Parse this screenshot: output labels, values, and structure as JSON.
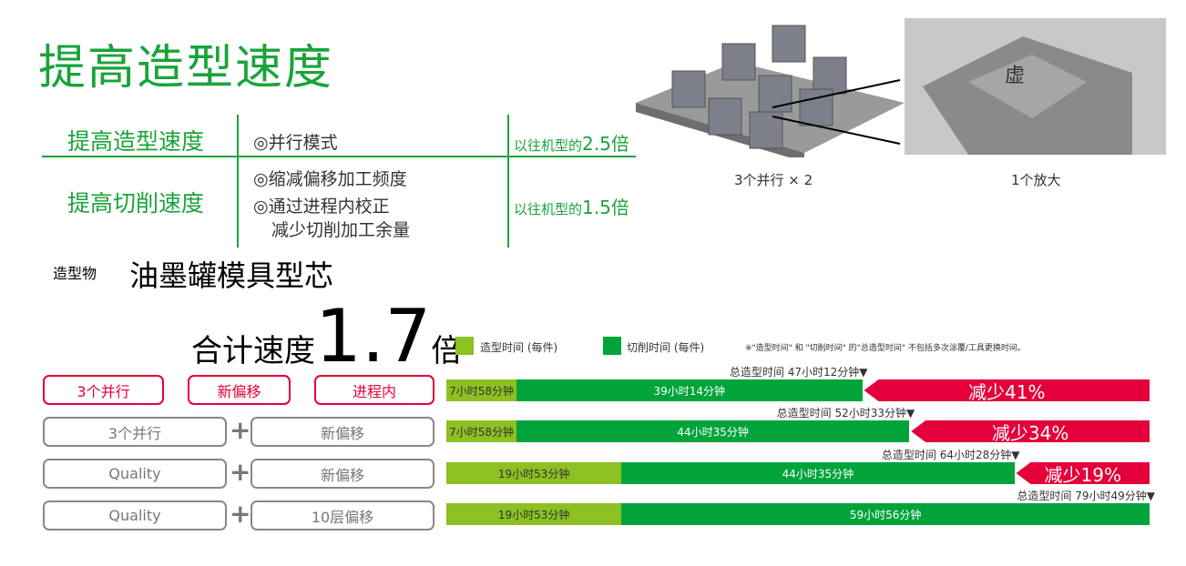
{
  "title": "提高造型速度",
  "table": {
    "rows": [
      {
        "label": "提高造型速度",
        "items": [
          "◎并行模式"
        ],
        "ratio_prefix": "以往机型的",
        "ratio_value": "2.5倍"
      },
      {
        "label": "提高切削速度",
        "items": [
          "◎缩减偏移加工频度",
          "◎通过进程内校正",
          "减少切削加工余量"
        ],
        "ratio_prefix": "以往机型的",
        "ratio_value": "1.5倍"
      }
    ]
  },
  "images": {
    "left_caption": "3个并行 × 2",
    "right_caption": "1个放大"
  },
  "object": {
    "label": "造型物",
    "name": "油墨罐模具型芯"
  },
  "headline": {
    "prefix": "合计速度",
    "value": "1.7",
    "suffix": "倍"
  },
  "legend": {
    "build": "造型时间 (每件)",
    "cut": "切削时间 (每件)",
    "note": "※\"造型时间\" 和 \"切削时间\" 的\"总造型时间\" 不包括多次涂覆/工具更换时间。"
  },
  "colors": {
    "green": "#1aa33a",
    "build": "#8dc022",
    "cut": "#00a43a",
    "red": "#e4003a"
  },
  "conditions": [
    {
      "items": [
        "3个并行",
        "新偏移",
        "进程内"
      ],
      "style": "red"
    },
    {
      "items": [
        "3个并行",
        "新偏移"
      ],
      "style": "gray",
      "plus": "+"
    },
    {
      "items": [
        "Quality",
        "新偏移"
      ],
      "style": "gray",
      "plus": "+"
    },
    {
      "items": [
        "Quality",
        "10层偏移"
      ],
      "style": "gray",
      "plus": "+"
    }
  ],
  "chart_data": {
    "type": "bar",
    "orientation": "horizontal-stacked",
    "unit": "hours",
    "series": [
      {
        "name": "造型时间 (每件)",
        "values": [
          7.967,
          7.967,
          19.883,
          19.883
        ]
      },
      {
        "name": "切削时间 (每件)",
        "values": [
          39.233,
          44.583,
          44.583,
          59.933
        ]
      }
    ],
    "segment_labels": [
      [
        "7小时58分钟",
        "39小时14分钟"
      ],
      [
        "7小时58分钟",
        "44小时35分钟"
      ],
      [
        "19小时53分钟",
        "44小时35分钟"
      ],
      [
        "19小时53分钟",
        "59小时56分钟"
      ]
    ],
    "total_label": "总造型时间",
    "totals": [
      "47小时12分钟▼",
      "52小时33分钟▼",
      "64小时28分钟▼",
      "79小时49分钟▼"
    ],
    "total_values": [
      47.2,
      52.55,
      64.467,
      79.817
    ],
    "reductions": [
      "减少41%",
      "减少34%",
      "减少19%",
      ""
    ],
    "xlim": [
      0,
      79.817
    ]
  }
}
